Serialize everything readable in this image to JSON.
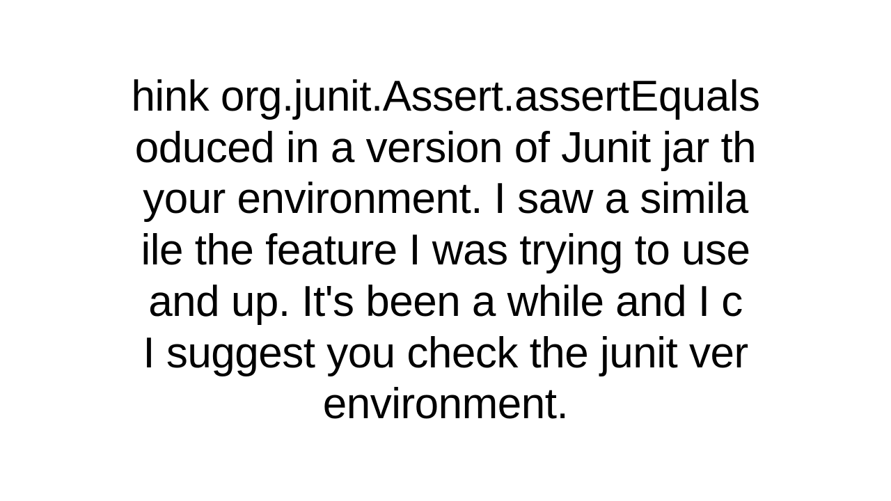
{
  "lines": {
    "l1": "hink org.junit.Assert.assertEquals",
    "l2": "oduced in a version of Junit jar th",
    "l3": "your environment.  I saw a simila",
    "l4": "ile the feature I was trying to use",
    "l5": " and up. It's been a while and I c",
    "l6": "I suggest you check the junit ver",
    "l7": "environment."
  }
}
